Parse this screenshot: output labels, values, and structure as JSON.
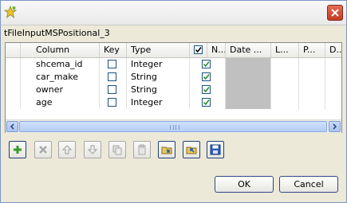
{
  "window": {
    "component_name": "tFileInputMSPositional_3",
    "close_label": "×"
  },
  "table": {
    "columns": [
      "Column",
      "Key",
      "Type",
      "N...",
      "Date ...",
      "L...",
      "P...",
      "D..."
    ],
    "rows": [
      {
        "column": "shcema_id",
        "key": false,
        "type": "Integer",
        "nullable": true
      },
      {
        "column": "car_make",
        "key": false,
        "type": "String",
        "nullable": true
      },
      {
        "column": "owner",
        "key": false,
        "type": "String",
        "nullable": true
      },
      {
        "column": "age",
        "key": false,
        "type": "Integer",
        "nullable": true
      }
    ]
  },
  "toolbar": {
    "buttons": [
      "add-row-icon",
      "remove-row-icon",
      "move-up-icon",
      "move-down-icon",
      "copy-icon",
      "paste-icon",
      "import-schema-icon",
      "export-schema-icon",
      "save-icon"
    ]
  },
  "buttons": {
    "ok": "OK",
    "cancel": "Cancel"
  },
  "colors": {
    "accent": "#1c5180",
    "close": "#c43b24",
    "green": "#2e8b2e"
  }
}
